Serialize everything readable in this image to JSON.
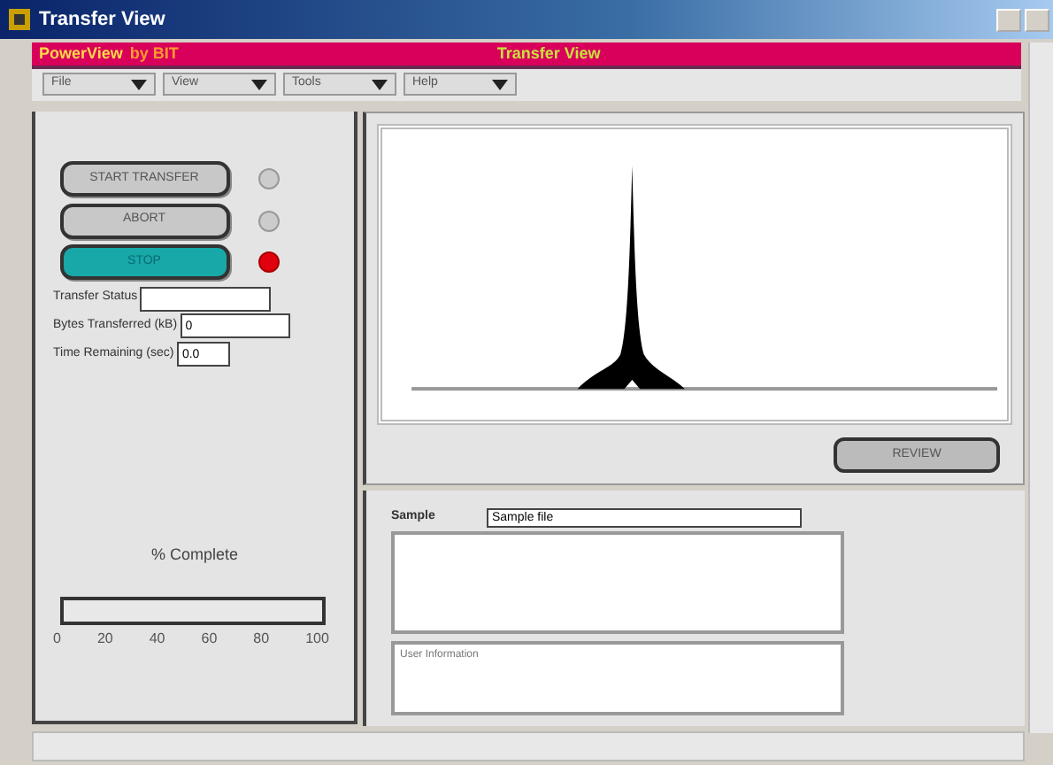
{
  "window": {
    "title": "Transfer View"
  },
  "header": {
    "app": "PowerView",
    "by": "by BIT",
    "title": "Transfer View"
  },
  "menus": [
    {
      "label": "File"
    },
    {
      "label": "View"
    },
    {
      "label": "Tools"
    },
    {
      "label": "Help"
    }
  ],
  "controls": [
    {
      "label": "START TRANSFER",
      "active": false,
      "light_on": false
    },
    {
      "label": "ABORT",
      "active": false,
      "light_on": false
    },
    {
      "label": "STOP",
      "active": true,
      "light_on": true
    }
  ],
  "fields": [
    {
      "label": "Transfer Status"
    },
    {
      "label": "Bytes Transferred (kB)",
      "value": "0"
    },
    {
      "label": "Time Remaining (sec)",
      "value": "0.0"
    }
  ],
  "progress": {
    "label": "% Complete",
    "level": 0,
    "ticks": [
      "0",
      "20",
      "40",
      "60",
      "80",
      "100"
    ]
  },
  "review_button": "REVIEW",
  "sample": {
    "label": "Sample",
    "value": "Sample file"
  },
  "user_info": {
    "text": "User Information"
  }
}
